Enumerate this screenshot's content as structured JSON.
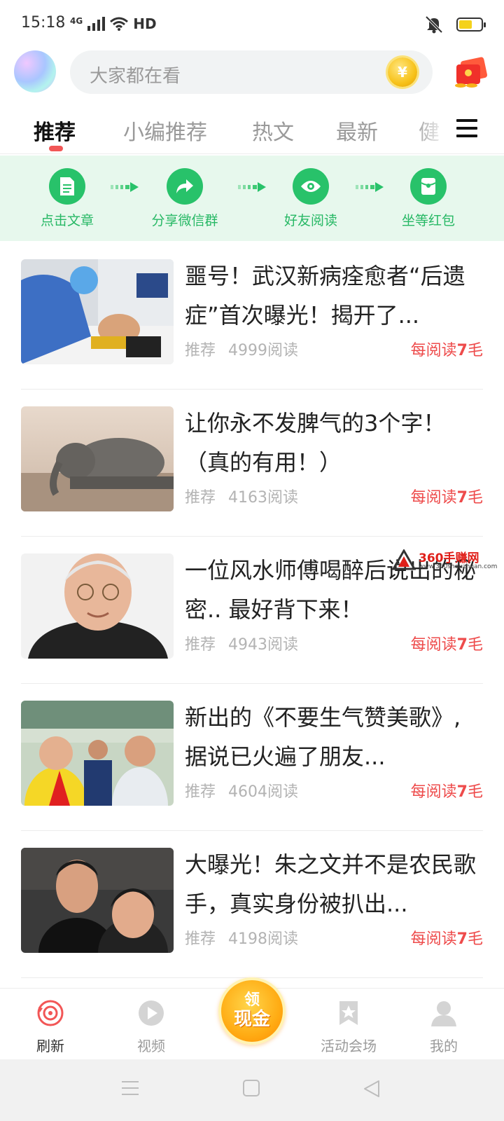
{
  "status_bar": {
    "time": "15:18",
    "network": "4G",
    "hd": "HD",
    "battery_level": 0.6,
    "battery_color": "#f4d21c"
  },
  "header": {
    "search_placeholder": "大家都在看",
    "coin_symbol": "¥",
    "avatar_icon": "avatar-gradient",
    "redpacket_icon": "red-envelope-icon"
  },
  "tabs": {
    "items": [
      "推荐",
      "小编推荐",
      "热文",
      "最新",
      "健"
    ],
    "active_index": 0,
    "indicator_color": "#f25656"
  },
  "steps": [
    {
      "label": "点击文章",
      "icon": "document-icon"
    },
    {
      "label": "分享微信群",
      "icon": "share-icon"
    },
    {
      "label": "好友阅读",
      "icon": "eye-icon"
    },
    {
      "label": "坐等红包",
      "icon": "red-packet-icon"
    }
  ],
  "articles": [
    {
      "title": "噩号！武汉新病痊愈者“后遗症”首次曝光！揭开了...",
      "tag": "推荐",
      "reads": "4999阅读",
      "reward_prefix": "每阅读",
      "reward_num": "7",
      "reward_suffix": "毛"
    },
    {
      "title": "让你永不发脾气的3个字！（真的有用！）",
      "tag": "推荐",
      "reads": "4163阅读",
      "reward_prefix": "每阅读",
      "reward_num": "7",
      "reward_suffix": "毛"
    },
    {
      "title": "一位风水师傅喝醉后说出的秘密.. 最好背下来！",
      "tag": "推荐",
      "reads": "4943阅读",
      "reward_prefix": "每阅读",
      "reward_num": "7",
      "reward_suffix": "毛"
    },
    {
      "title": "新出的《不要生气赞美歌》,据说已火遍了朋友...",
      "tag": "推荐",
      "reads": "4604阅读",
      "reward_prefix": "每阅读",
      "reward_num": "7",
      "reward_suffix": "毛"
    },
    {
      "title": "大曝光！朱之文并不是农民歌手，真实身份被扒出...",
      "tag": "推荐",
      "reads": "4198阅读",
      "reward_prefix": "每阅读",
      "reward_num": "7",
      "reward_suffix": "毛"
    }
  ],
  "watermark": {
    "text": "360手赚网",
    "url": "www.360shouzhuan.com"
  },
  "bottom_nav": {
    "items": [
      {
        "label": "刷新",
        "icon": "refresh-icon"
      },
      {
        "label": "视频",
        "icon": "play-icon"
      },
      {
        "label": "活动会场",
        "icon": "star-bookmark-icon"
      },
      {
        "label": "我的",
        "icon": "user-icon"
      }
    ],
    "cash_top": "领",
    "cash_bottom": "现金",
    "accent": "#f25656"
  }
}
